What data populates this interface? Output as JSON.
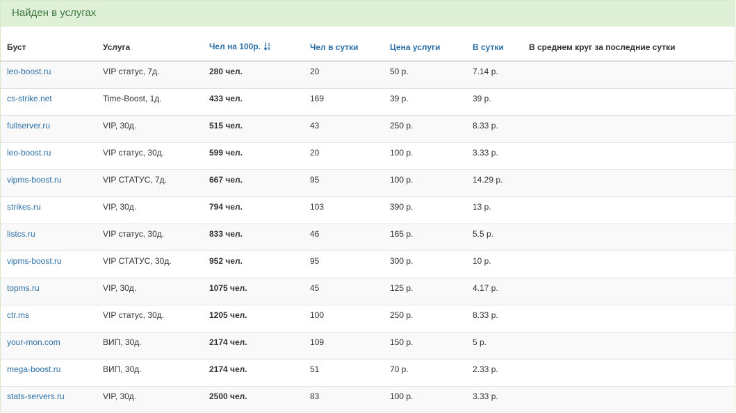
{
  "panel": {
    "title": "Найден в услугах"
  },
  "colors": {
    "link": "#2a6fa8",
    "heading_bg": "#dff0d8",
    "heading_text": "#3c763d"
  },
  "table": {
    "columns": [
      {
        "label": "Буст",
        "sortable": false
      },
      {
        "label": "Услуга",
        "sortable": false
      },
      {
        "label": "Чел на 100р.",
        "sortable": true,
        "sorted": "ascending",
        "icon": "sort-numeric-asc-icon"
      },
      {
        "label": "Чел в сутки",
        "sortable": true
      },
      {
        "label": "Цена услуги",
        "sortable": true
      },
      {
        "label": "В сутки",
        "sortable": true
      },
      {
        "label": "В среднем круг за последние сутки",
        "sortable": false
      }
    ],
    "rows": [
      {
        "site": "leo-boost.ru",
        "service": "VIP статус, 7д.",
        "per100": "280 чел.",
        "per_day": "20",
        "price": "50 р.",
        "daily": "7.14 р.",
        "avg": ""
      },
      {
        "site": "cs-strike.net",
        "service": "Time-Boost, 1д.",
        "per100": "433 чел.",
        "per_day": "169",
        "price": "39 р.",
        "daily": "39 р.",
        "avg": ""
      },
      {
        "site": "fullserver.ru",
        "service": "VIP, 30д.",
        "per100": "515 чел.",
        "per_day": "43",
        "price": "250 р.",
        "daily": "8.33 р.",
        "avg": ""
      },
      {
        "site": "leo-boost.ru",
        "service": "VIP статус, 30д.",
        "per100": "599 чел.",
        "per_day": "20",
        "price": "100 р.",
        "daily": "3.33 р.",
        "avg": ""
      },
      {
        "site": "vipms-boost.ru",
        "service": "VIP СТАТУС, 7д.",
        "per100": "667 чел.",
        "per_day": "95",
        "price": "100 р.",
        "daily": "14.29 р.",
        "avg": ""
      },
      {
        "site": "strikes.ru",
        "service": "VIP, 30д.",
        "per100": "794 чел.",
        "per_day": "103",
        "price": "390 р.",
        "daily": "13 р.",
        "avg": ""
      },
      {
        "site": "listcs.ru",
        "service": "VIP статус, 30д.",
        "per100": "833 чел.",
        "per_day": "46",
        "price": "165 р.",
        "daily": "5.5 р.",
        "avg": ""
      },
      {
        "site": "vipms-boost.ru",
        "service": "VIP СТАТУС, 30д.",
        "per100": "952 чел.",
        "per_day": "95",
        "price": "300 р.",
        "daily": "10 р.",
        "avg": ""
      },
      {
        "site": "topms.ru",
        "service": "VIP, 30д.",
        "per100": "1075 чел.",
        "per_day": "45",
        "price": "125 р.",
        "daily": "4.17 р.",
        "avg": ""
      },
      {
        "site": "ctr.ms",
        "service": "VIP статус, 30д.",
        "per100": "1205 чел.",
        "per_day": "100",
        "price": "250 р.",
        "daily": "8.33 р.",
        "avg": ""
      },
      {
        "site": "your-mon.com",
        "service": "ВИП, 30д.",
        "per100": "2174 чел.",
        "per_day": "109",
        "price": "150 р.",
        "daily": "5 р.",
        "avg": ""
      },
      {
        "site": "mega-boost.ru",
        "service": "ВИП, 30д.",
        "per100": "2174 чел.",
        "per_day": "51",
        "price": "70 р.",
        "daily": "2.33 р.",
        "avg": ""
      },
      {
        "site": "stats-servers.ru",
        "service": "VIP, 30д.",
        "per100": "2500 чел.",
        "per_day": "83",
        "price": "100 р.",
        "daily": "3.33 р.",
        "avg": ""
      }
    ]
  }
}
